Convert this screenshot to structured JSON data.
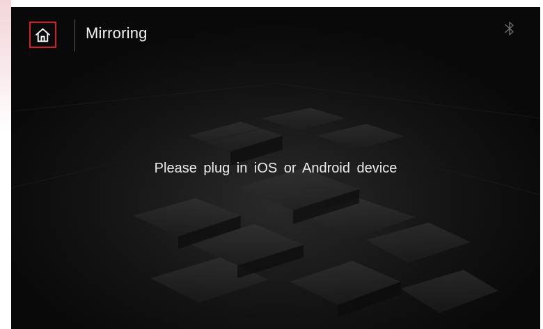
{
  "header": {
    "title": "Mirroring"
  },
  "icons": {
    "home": "home-icon",
    "bluetooth": "bluetooth-icon"
  },
  "main": {
    "message": "Please plug in iOS or Android device"
  },
  "colors": {
    "accent": "#d81f26",
    "background": "#090909",
    "text": "#f2f2f2"
  }
}
